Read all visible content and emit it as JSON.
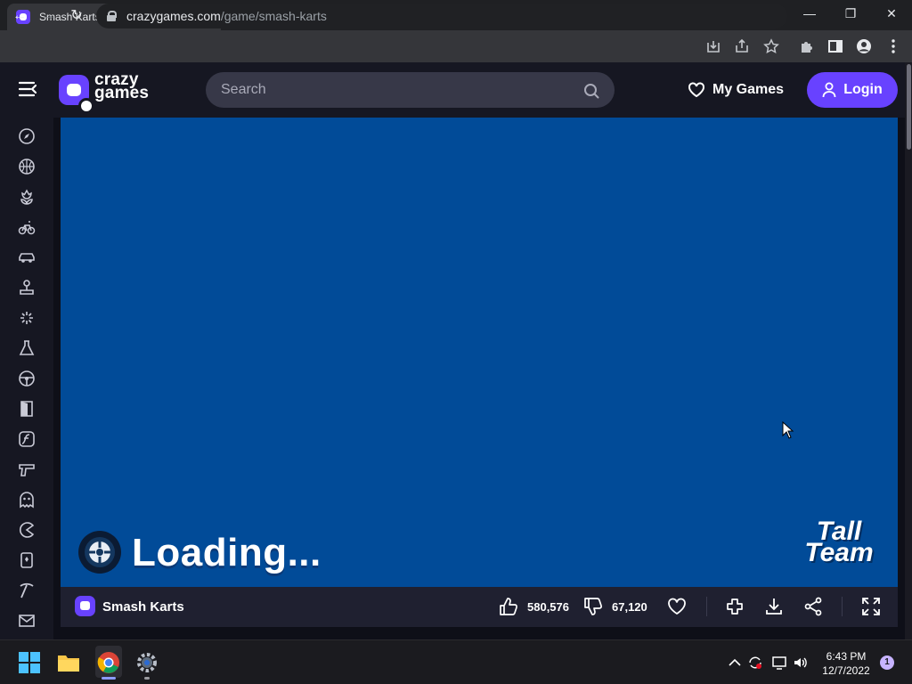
{
  "browser": {
    "tab_title": "Smash Karts | CrazyGames - Play",
    "url_host": "crazygames.com",
    "url_path": "/game/smash-karts"
  },
  "header": {
    "logo_text_line1": "crazy",
    "logo_text_line2": "games",
    "search_placeholder": "Search",
    "my_games_label": "My Games",
    "login_label": "Login"
  },
  "sidebar": {
    "icons": [
      "compass-icon",
      "basketball-icon",
      "flower-icon",
      "bicycle-icon",
      "car-icon",
      "joystick-icon",
      "sparkle-icon",
      "flask-icon",
      "steering-wheel-icon",
      "door-icon",
      "flash-icon",
      "gun-icon",
      "ghost-icon",
      "pacman-icon",
      "card-icon",
      "pickaxe-icon",
      "mail-icon"
    ]
  },
  "game": {
    "loading_text": "Loading...",
    "studio_line1": "Tall",
    "studio_line2": "Team",
    "background_color": "#014b98"
  },
  "game_bar": {
    "title": "Smash Karts",
    "likes": "580,576",
    "dislikes": "67,120"
  },
  "taskbar": {
    "time": "6:43 PM",
    "date": "12/7/2022",
    "notification_count": "1"
  },
  "colors": {
    "accent": "#6842ff",
    "header_bg": "#161722",
    "game_bg": "#014b98"
  }
}
